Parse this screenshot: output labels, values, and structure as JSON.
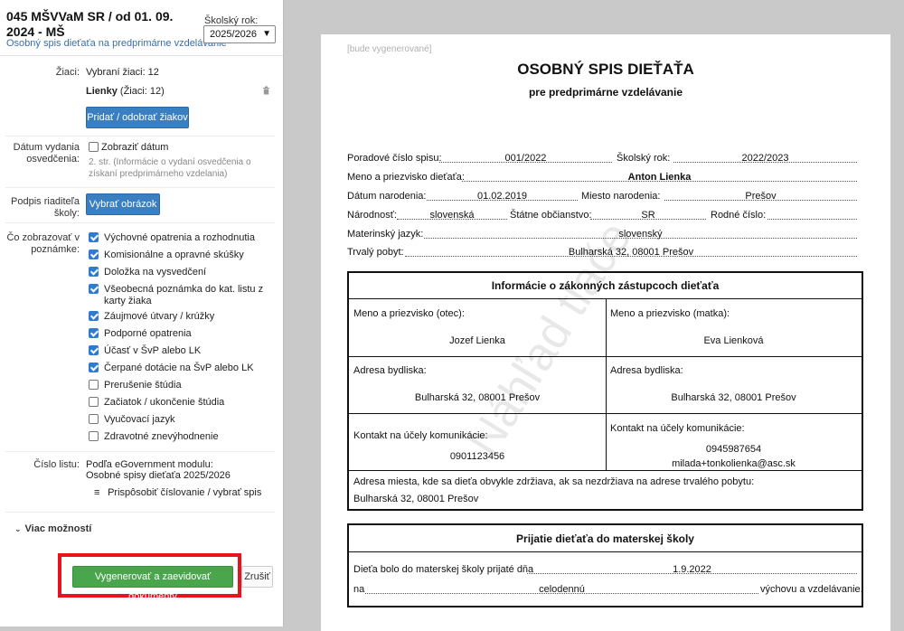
{
  "header": {
    "title": "045 MŠVVaM SR / od 01. 09. 2024 - MŠ",
    "subtitle": "Osobný spis dieťaťa na predprimárne vzdelávanie",
    "year_label": "Školský rok:",
    "year_value": "2025/2026"
  },
  "students": {
    "label": "Žiaci:",
    "selected": "Vybraní žiaci: 12",
    "group_name": "Lienky",
    "group_count": "(Žiaci: 12)",
    "button": "Pridať / odobrať žiakov"
  },
  "issue_date": {
    "label": "Dátum vydania osvedčenia:",
    "checkbox_label": "Zobraziť dátum",
    "note": "2. str. (Informácie o vydaní osvedčenia o získaní predprimárneho vzdelania)"
  },
  "signature": {
    "label": "Podpis riaditeľa školy:",
    "button": "Vybrať obrázok"
  },
  "notes": {
    "label": "Čo zobrazovať v poznámke:",
    "items": [
      {
        "label": "Výchovné opatrenia a rozhodnutia",
        "checked": true
      },
      {
        "label": "Komisionálne a opravné skúšky",
        "checked": true
      },
      {
        "label": "Doložka na vysvedčení",
        "checked": true
      },
      {
        "label": "Všeobecná poznámka do kat. listu z karty žiaka",
        "checked": true
      },
      {
        "label": "Záujmové útvary / krúžky",
        "checked": true
      },
      {
        "label": "Podporné opatrenia",
        "checked": true
      },
      {
        "label": "Účasť v ŠvP alebo LK",
        "checked": true
      },
      {
        "label": "Čerpané dotácie na ŠvP alebo LK",
        "checked": true
      },
      {
        "label": "Prerušenie štúdia",
        "checked": false
      },
      {
        "label": "Začiatok / ukončenie štúdia",
        "checked": false
      },
      {
        "label": "Vyučovací jazyk",
        "checked": false
      },
      {
        "label": "Zdravotné znevýhodnenie",
        "checked": false
      }
    ]
  },
  "sheet_number": {
    "label": "Číslo listu:",
    "line1": "Podľa eGovernment modulu:",
    "line2": "Osobné spisy dieťaťa 2025/2026",
    "customize": "Prispôsobiť číslovanie / vybrať spis"
  },
  "more_options": "Viac možností",
  "actions": {
    "generate": "Vygenerovať a zaevidovať dokumenty",
    "cancel": "Zrušiť"
  },
  "preview": {
    "gen_note": "[bude vygenerované]",
    "title": "OSOBNÝ SPIS DIEŤAŤA",
    "subtitle": "pre predprimárne vzdelávanie",
    "watermark": "Náhľad tlače",
    "fields": {
      "file_no_label": "Poradové číslo spisu:",
      "file_no": "001/2022",
      "year_label": "Školský rok:",
      "year": "2022/2023",
      "name_label": "Meno a priezvisko dieťaťa:",
      "name": "Anton Lienka",
      "dob_label": "Dátum narodenia:",
      "dob": "01.02.2019",
      "pob_label": "Miesto narodenia:",
      "pob": "Prešov",
      "nationality_label": "Národnosť:",
      "nationality": "slovenská",
      "citizenship_label": "Štátne občianstvo:",
      "citizenship": "SR",
      "birth_no_label": "Rodné číslo:",
      "language_label": "Materinský jazyk:",
      "language": "slovenský",
      "address_label": "Trvalý pobyt:",
      "address": "Bulharská 32, 08001 Prešov"
    },
    "guardians": {
      "heading": "Informácie o zákonných zástupcoch dieťaťa",
      "father_label": "Meno a priezvisko (otec):",
      "father": "Jozef Lienka",
      "mother_label": "Meno a priezvisko (matka):",
      "mother": "Eva Lienková",
      "addr_label_1": "Adresa bydliska:",
      "addr_1": "Bulharská 32, 08001 Prešov",
      "addr_label_2": "Adresa bydliska:",
      "addr_2": "Bulharská 32, 08001 Prešov",
      "contact_label_1": "Kontakt na účely komunikácie:",
      "contact_1": "0901123456",
      "contact_label_2": "Kontakt na účely komunikácie:",
      "contact_2a": "0945987654",
      "contact_2b": "milada+tonkolienka@asc.sk",
      "residence_label": "Adresa miesta, kde sa dieťa obvykle zdržiava, ak sa nezdržiava na adrese trvalého pobytu:",
      "residence": "Bulharská 32, 08001 Prešov"
    },
    "admission": {
      "heading": "Prijatie dieťaťa do materskej školy",
      "line1_label": "Dieťa bolo do materskej školy prijaté dňa",
      "line1_value": "1.9.2022",
      "line2_prefix": "na",
      "line2_mid": "celodennú",
      "line2_suffix": "výchovu a vzdelávanie."
    }
  }
}
